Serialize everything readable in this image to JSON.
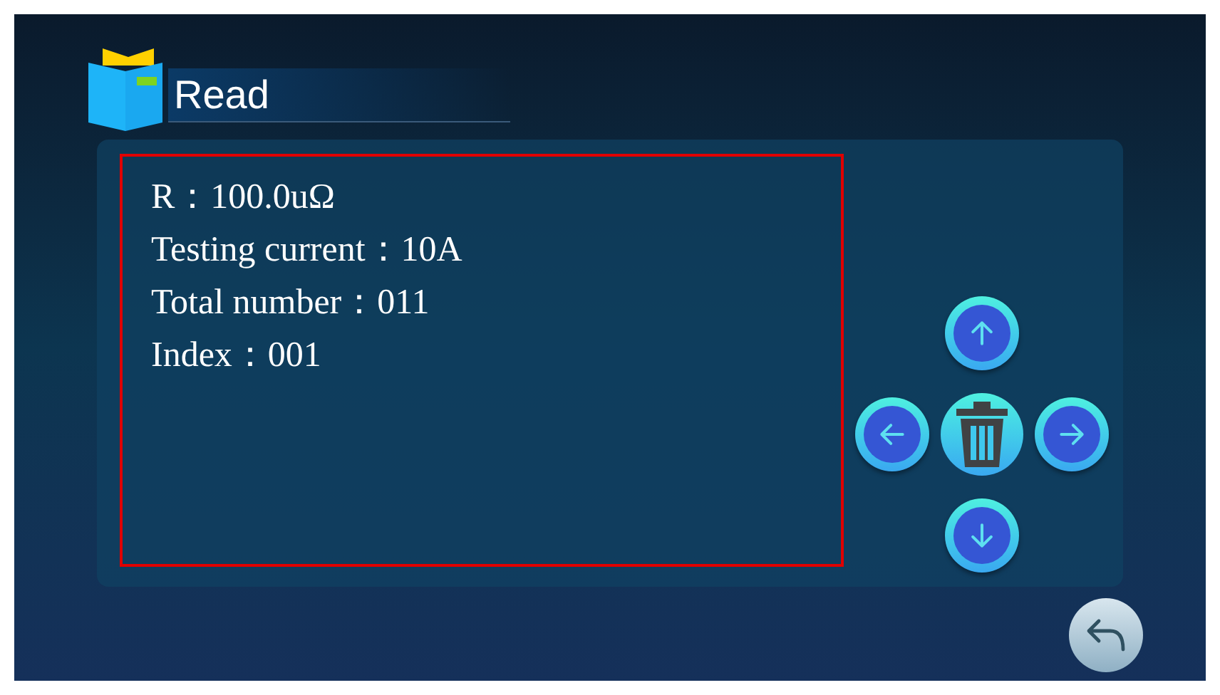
{
  "header": {
    "title": "Read"
  },
  "readout": {
    "lines": [
      "R：100.0uΩ",
      "Testing current：10A",
      "Total number：011",
      "Index：001"
    ]
  }
}
